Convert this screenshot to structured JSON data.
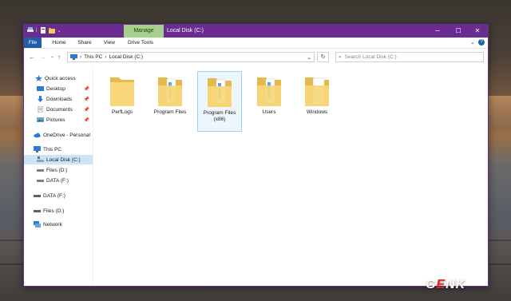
{
  "window": {
    "title": "Local Disk (C:)",
    "manage_tab": "Manage",
    "controls": {
      "minimize": "─",
      "maximize": "☐",
      "close": "✕"
    }
  },
  "ribbon": {
    "tabs": [
      "File",
      "Home",
      "Share",
      "View",
      "Drive Tools"
    ],
    "expand": "⌄",
    "help": "?"
  },
  "address": {
    "back": "←",
    "forward": "→",
    "recent": "⌄",
    "up": "↑",
    "path": [
      "This PC",
      "Local Disk (C:)"
    ],
    "sep": "›",
    "dropdown": "⌄",
    "refresh": "↻"
  },
  "search": {
    "placeholder": "Search Local Disk (C:)",
    "icon": "⌕"
  },
  "nav": {
    "quick_access": "Quick access",
    "quick_items": [
      {
        "label": "Desktop",
        "pinned": true
      },
      {
        "label": "Downloads",
        "pinned": true
      },
      {
        "label": "Documents",
        "pinned": true
      },
      {
        "label": "Pictures",
        "pinned": true
      }
    ],
    "pin_glyph": "📌",
    "onedrive": "OneDrive - Personal",
    "this_pc": "This PC",
    "drives": [
      "Local Disk (C:)",
      "Files (D:)",
      "DATA (F:)"
    ],
    "extra_drives": [
      "DATA (F:)",
      "Files (D:)"
    ],
    "network": "Network"
  },
  "folders": [
    {
      "line1": "PerfLogs",
      "line2": ""
    },
    {
      "line1": "Program Files",
      "line2": ""
    },
    {
      "line1": "Program Files",
      "line2": "(x86)"
    },
    {
      "line1": "Users",
      "line2": ""
    },
    {
      "line1": "Windows",
      "line2": ""
    }
  ],
  "watermark": {
    "g": "G",
    "e": "E",
    "nk": "NK"
  },
  "colors": {
    "titlebar": "#6a2c91",
    "manage": "#a8d08d",
    "file_tab": "#1f5fa8",
    "selected": "#cce4f7"
  }
}
